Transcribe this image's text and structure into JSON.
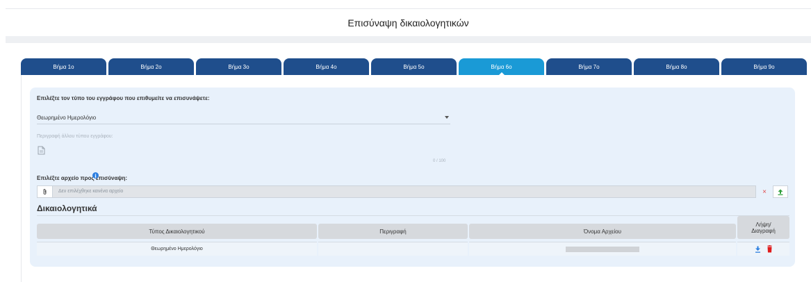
{
  "header": {
    "title": "Επισύναψη δικαιολογητικών"
  },
  "tabs": [
    {
      "label": "Βήμα 1ο",
      "active": false
    },
    {
      "label": "Βήμα 2ο",
      "active": false
    },
    {
      "label": "Βήμα 3ο",
      "active": false
    },
    {
      "label": "Βήμα 4ο",
      "active": false
    },
    {
      "label": "Βήμα 5ο",
      "active": false
    },
    {
      "label": "Βήμα 6ο",
      "active": true
    },
    {
      "label": "Βήμα 7ο",
      "active": false
    },
    {
      "label": "Βήμα 8ο",
      "active": false
    },
    {
      "label": "Βήμα 9ο",
      "active": false
    }
  ],
  "form": {
    "doc_type_label": "Επιλέξτε τον τύπο του εγγράφου που επιθυμείτε να επισυνάψετε:",
    "doc_type_value": "Θεωρημένο Ημερολόγιο",
    "other_desc_label": "Περιγραφή άλλου τύπου εγγράφου:",
    "counter": "0 / 100",
    "file_label": "Επιλέξτε αρχείο προς επισύναψη:",
    "file_placeholder": "Δεν επιλέχθηκε κανένα αρχείο",
    "clear_symbol": "×"
  },
  "documents": {
    "title": "Δικαιολογητικά",
    "headers": {
      "type": "Τύπος Δικαιολογητικού",
      "description": "Περιγραφή",
      "filename": "Όνομα Αρχείου",
      "actions_line1": "Λήψη/",
      "actions_line2": "Διαγραφή"
    },
    "rows": [
      {
        "type": "Θεωρημένο Ημερολόγιο",
        "description": "",
        "filename": ""
      }
    ]
  },
  "colors": {
    "tab": "#1f4e8c",
    "tab_active": "#1a9ad6",
    "panel": "#e8f1fb",
    "download": "#2b7ee0",
    "delete": "#e01b1b",
    "upload": "#2e9e3a"
  }
}
